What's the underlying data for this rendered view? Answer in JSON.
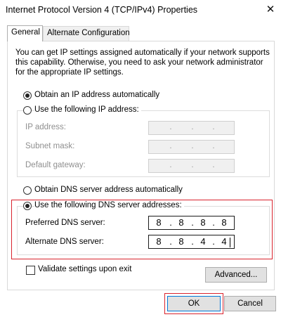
{
  "window": {
    "title": "Internet Protocol Version 4 (TCP/IPv4) Properties",
    "close_glyph": "✕"
  },
  "tabs": [
    {
      "label": "General",
      "selected": true
    },
    {
      "label": "Alternate Configuration",
      "selected": false
    }
  ],
  "description": [
    "You can get IP settings assigned automatically if your network supports",
    "this capability. Otherwise, you need to ask your network administrator",
    "for the appropriate IP settings."
  ],
  "ip_settings": {
    "auto_label": "Obtain an IP address automatically",
    "auto_selected": true,
    "manual_label": "Use the following IP address:",
    "manual_selected": false,
    "fields": [
      {
        "label": "IP address:",
        "octets": [
          "",
          "",
          "",
          ""
        ],
        "enabled": false
      },
      {
        "label": "Subnet mask:",
        "octets": [
          "",
          "",
          "",
          ""
        ],
        "enabled": false
      },
      {
        "label": "Default gateway:",
        "octets": [
          "",
          "",
          "",
          ""
        ],
        "enabled": false
      }
    ]
  },
  "dns_settings": {
    "auto_label": "Obtain DNS server address automatically",
    "auto_selected": false,
    "manual_label": "Use the following DNS server addresses:",
    "manual_selected": true,
    "preferred": {
      "label": "Preferred DNS server:",
      "octets": [
        "8",
        "8",
        "8",
        "8"
      ]
    },
    "alternate": {
      "label": "Alternate DNS server:",
      "octets": [
        "8",
        "8",
        "4",
        "4"
      ]
    }
  },
  "validate": {
    "label": "Validate settings upon exit",
    "checked": false
  },
  "buttons": {
    "advanced": "Advanced...",
    "ok": "OK",
    "cancel": "Cancel"
  },
  "highlight_color": "#d9232d"
}
